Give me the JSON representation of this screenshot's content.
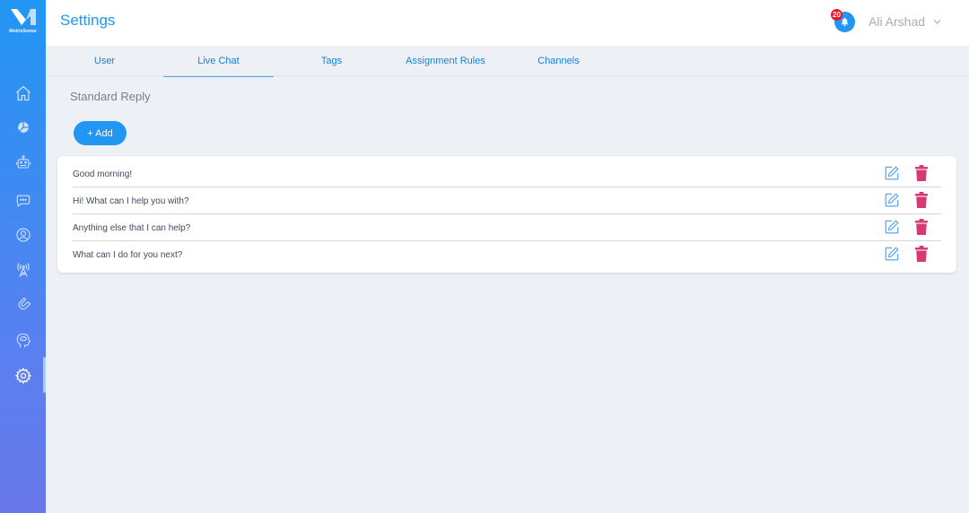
{
  "app": {
    "logo_text": "MetrixSense",
    "colors": {
      "primary": "#2196f3",
      "sidebar_bottom": "#6878e8",
      "delete": "#d63a72",
      "badge": "#e8192c"
    }
  },
  "sidebar": {
    "items": [
      {
        "name": "home",
        "icon": "home-icon"
      },
      {
        "name": "analytics",
        "icon": "pie-chart-icon"
      },
      {
        "name": "bot",
        "icon": "robot-icon"
      },
      {
        "name": "live-chat",
        "icon": "chat-bubble-icon"
      },
      {
        "name": "contacts",
        "icon": "user-circle-icon"
      },
      {
        "name": "broadcast",
        "icon": "antenna-icon"
      },
      {
        "name": "integrations",
        "icon": "magnet-icon"
      },
      {
        "name": "intelligence",
        "icon": "brain-head-icon"
      },
      {
        "name": "settings",
        "icon": "gear-icon",
        "active": true
      }
    ]
  },
  "header": {
    "title": "Settings",
    "notifications_count": "20",
    "user_name": "Ali Arshad"
  },
  "tabs": [
    {
      "label": "User",
      "active": false
    },
    {
      "label": "Live Chat",
      "active": true
    },
    {
      "label": "Tags",
      "active": false
    },
    {
      "label": "Assignment Rules",
      "active": false
    },
    {
      "label": "Channels",
      "active": false
    }
  ],
  "main": {
    "section_title": "Standard Reply",
    "add_button": "+ Add",
    "replies": [
      {
        "text": "Good morning!"
      },
      {
        "text": "Hi! What can I help you with?"
      },
      {
        "text": "Anything else that I can help?"
      },
      {
        "text": "What can I do for you next?"
      }
    ]
  }
}
